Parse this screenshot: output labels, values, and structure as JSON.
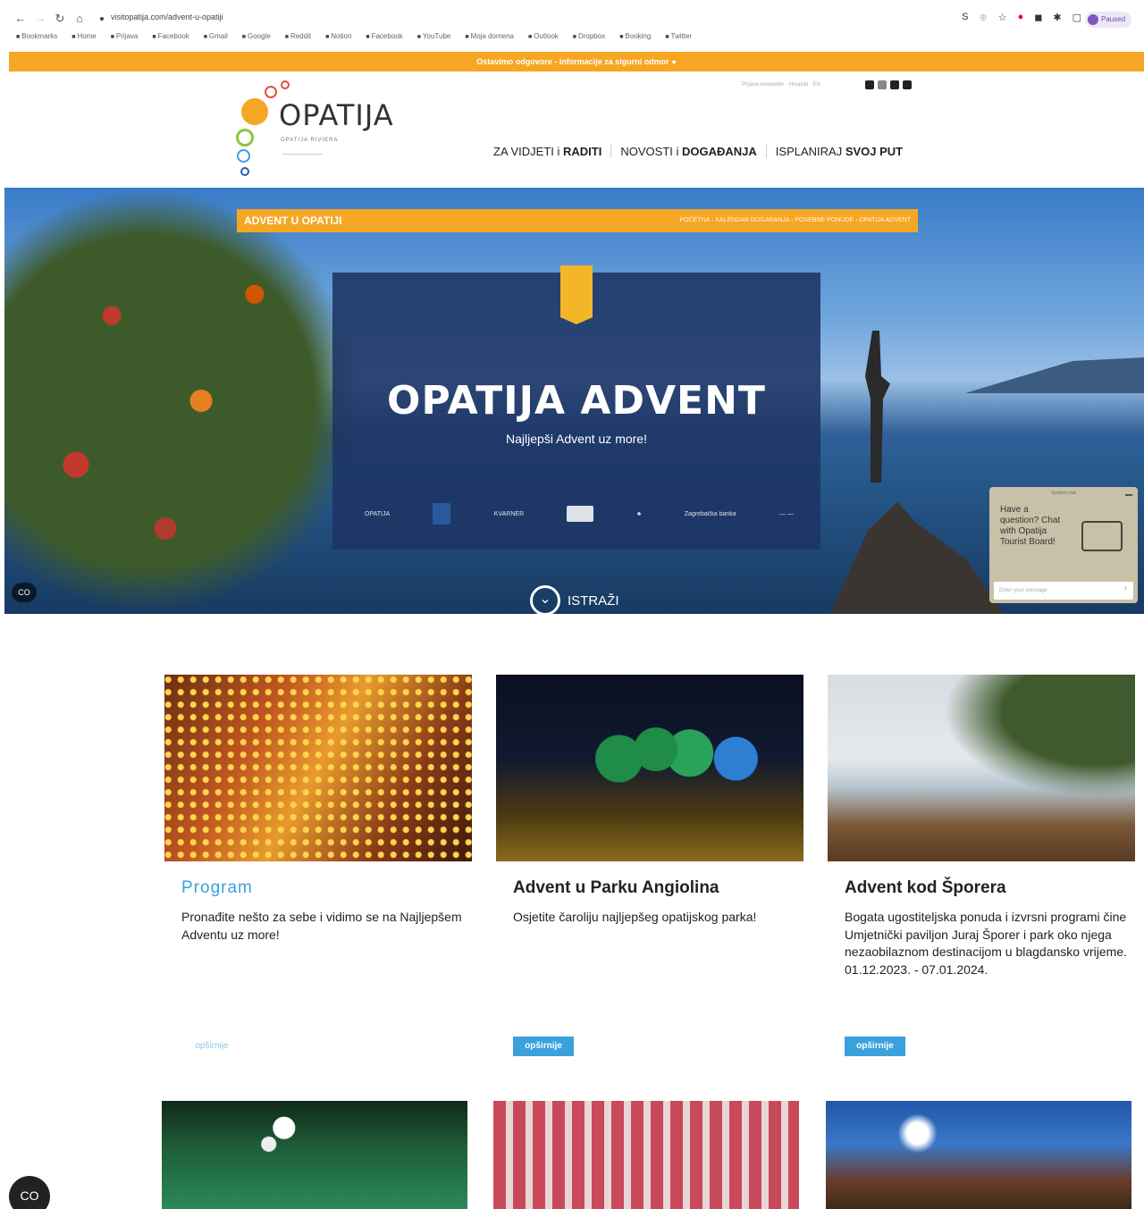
{
  "browser": {
    "url": "visitopatija.com/advent-u-opatiji",
    "profile_label": "Paused",
    "bookmarks": [
      "Bookmarks",
      "Home",
      "Prijava",
      "Facebook",
      "Gmail",
      "Google",
      "Reddit",
      "Notion",
      "Facebook",
      "YouTube",
      "Moja domena",
      "Outlook",
      "Dropbox",
      "Booking",
      "Twitter"
    ]
  },
  "notice": {
    "text": "Ostavimo odgovore - informacije za sigurni odmor"
  },
  "header": {
    "logo_text": "OPATIJA",
    "logo_sub": "OPATIJA RIVIERA",
    "top_links": "Prijava newsletter · Hrvatski · EN"
  },
  "nav": {
    "items": [
      {
        "light": "ZA VIDJETI i ",
        "bold": "RADITI"
      },
      {
        "light": "NOVOSTI i ",
        "bold": "DOGAĐANJA"
      },
      {
        "light": "ISPLANIRAJ ",
        "bold": "SVOJ PUT"
      }
    ]
  },
  "hero": {
    "breadcrumb_title": "ADVENT U OPATIJI",
    "breadcrumb_path": "POČETNA  ›  KALENDAR DOGAĐANJA  ›  POSEBNE PONUDE  ›  OPATIJA ADVENT",
    "banner_title": "OPATIJA ADVENT",
    "banner_subtitle": "Najljepši Advent uz more!",
    "sponsors": [
      "OPATIJA",
      "",
      "KVARNER",
      "",
      "",
      "Zagrebačka banka",
      ""
    ],
    "explore_label": "ISTRAŽI",
    "cc_label": "CO"
  },
  "chat": {
    "header": "Symbol chat",
    "text": "Have a question? Chat with Opatija Tourist Board!",
    "placeholder": "Enter your message"
  },
  "cards": [
    {
      "title": "Program",
      "text": "Pronađite nešto za sebe i vidimo se na Najljepšem Adventu uz more!",
      "button": "opširnije"
    },
    {
      "title": "Advent u Parku Angiolina",
      "text": "Osjetite čaroliju najljepšeg opatijskog parka!",
      "button": "opširnije"
    },
    {
      "title": "Advent kod Šporera",
      "text": "Bogata ugostiteljska ponuda i izvrsni programi čine Umjetnički paviljon Juraj Šporer i park oko njega nezaobilaznom destinacijom u blagdansko vrijeme. 01.12.2023. - 07.01.2024.",
      "button": "opširnije"
    }
  ],
  "floating_cc": "CO",
  "colors": {
    "accent_orange": "#f5a623",
    "accent_blue": "#3aa1dd",
    "banner_navy": "#1c3464"
  }
}
